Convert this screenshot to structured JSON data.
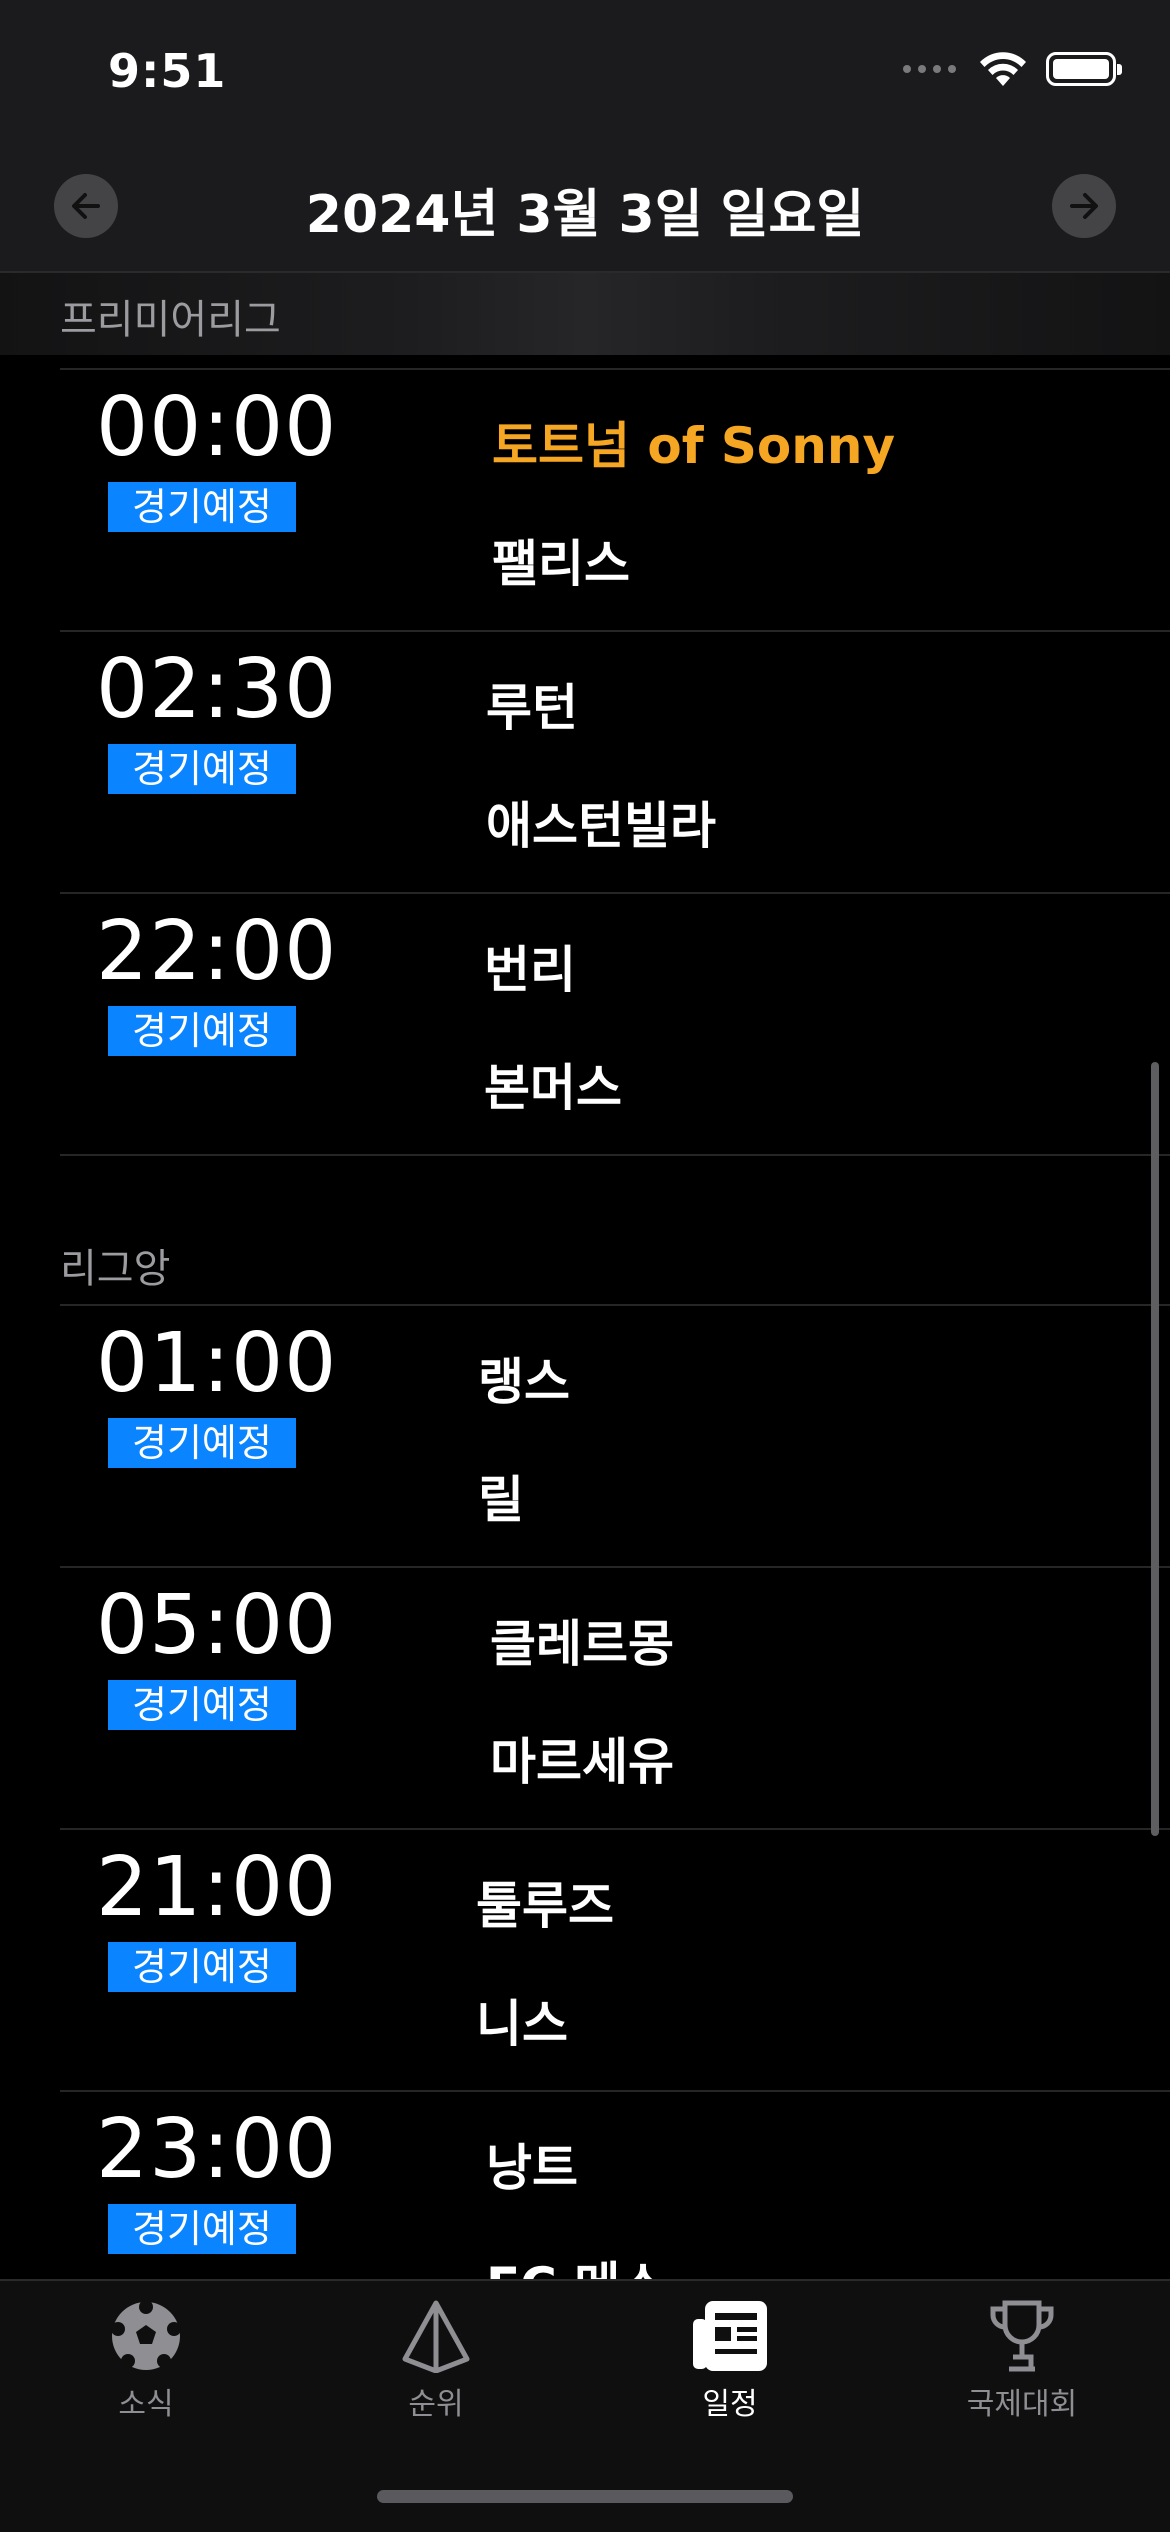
{
  "status_bar": {
    "time": "9:51"
  },
  "header": {
    "date_title": "2024년 3월 3일 일요일"
  },
  "sections": [
    {
      "title": "프리미어리그",
      "matches": [
        {
          "time": "00:00",
          "status": "경기예정",
          "home": "토트넘 of Sonny",
          "away": "팰리스"
        },
        {
          "time": "02:30",
          "status": "경기예정",
          "home": "루턴",
          "away": "애스턴빌라"
        },
        {
          "time": "22:00",
          "status": "경기예정",
          "home": "번리",
          "away": "본머스"
        }
      ]
    },
    {
      "title": "리그앙",
      "matches": [
        {
          "time": "01:00",
          "status": "경기예정",
          "home": "랭스",
          "away": "릴"
        },
        {
          "time": "05:00",
          "status": "경기예정",
          "home": "클레르몽",
          "away": "마르세유"
        },
        {
          "time": "21:00",
          "status": "경기예정",
          "home": "툴루즈",
          "away": "니스"
        },
        {
          "time": "23:00",
          "status": "경기예정",
          "home": "낭트",
          "away": "FC 메스"
        }
      ]
    }
  ],
  "tabs": [
    {
      "label": "소식",
      "icon": "soccer-ball-icon"
    },
    {
      "label": "순위",
      "icon": "pyramid-icon"
    },
    {
      "label": "일정",
      "icon": "newspaper-icon",
      "active": true
    },
    {
      "label": "국제대회",
      "icon": "trophy-icon"
    }
  ],
  "colors": {
    "accent": "#0a84ff",
    "highlight_team": "#f5a623",
    "background": "#000000",
    "topbar": "#1b1b1d"
  }
}
